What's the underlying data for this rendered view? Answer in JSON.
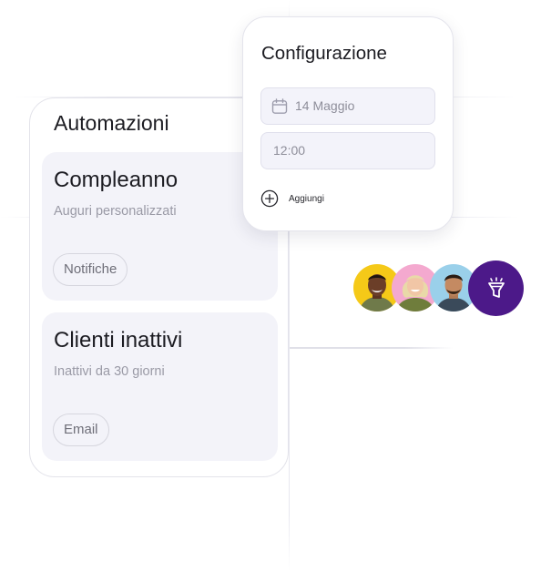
{
  "automations": {
    "title": "Automazioni",
    "items": [
      {
        "title": "Compleanno",
        "subtitle": "Auguri personalizzati",
        "chip": "Notifiche"
      },
      {
        "title": "Clienti inattivi",
        "subtitle": "Inattivi da 30 giorni",
        "chip": "Email"
      }
    ]
  },
  "config": {
    "title": "Configurazione",
    "date_value": "14 Maggio",
    "time_value": "12:00",
    "add_label": "Aggiungi"
  },
  "avatars": [
    {
      "icon": "person-avatar",
      "background": "#f5c918"
    },
    {
      "icon": "person-avatar",
      "background": "#f4a9cf"
    },
    {
      "icon": "person-avatar",
      "background": "#9ad0ea"
    }
  ],
  "funnel_button": {
    "icon": "funnel-icon",
    "background": "#4c1989"
  },
  "colors": {
    "card_background": "#f3f3f9",
    "field_background": "#f3f3fa",
    "accent": "#4c1989"
  }
}
